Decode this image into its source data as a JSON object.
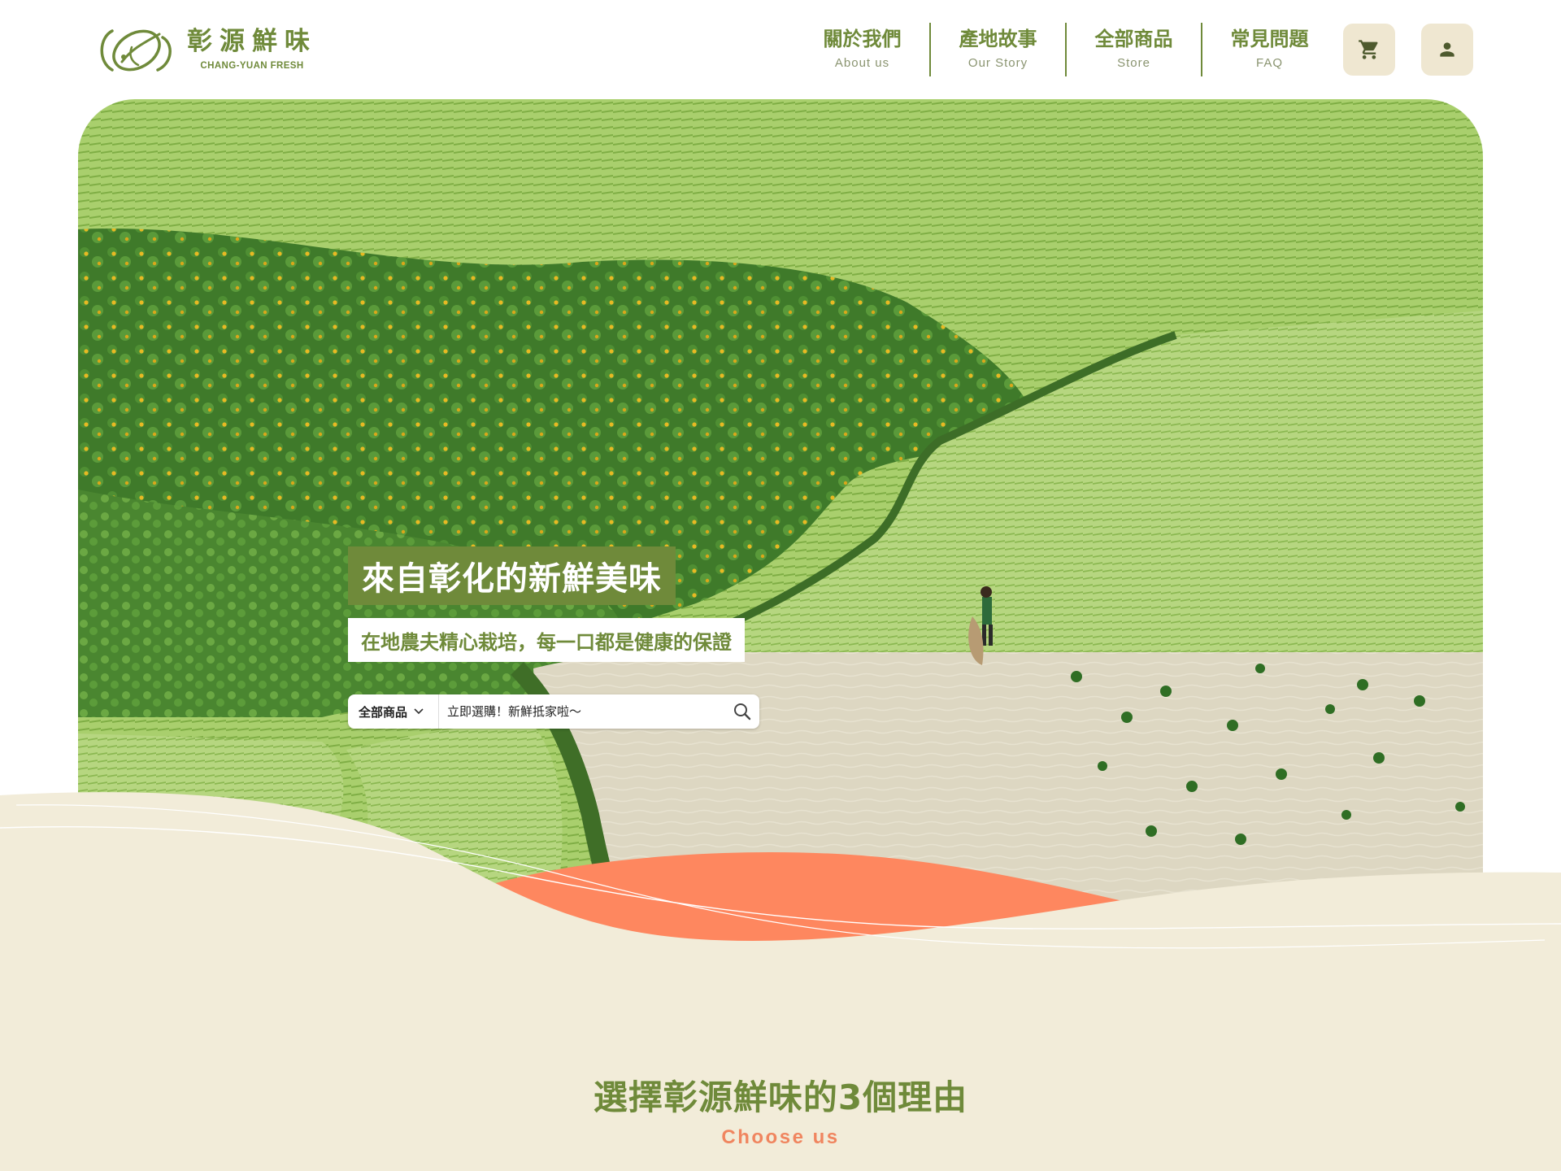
{
  "brand": {
    "name_zh": "彰源鮮味",
    "name_en": "CHANG-YUAN FRESH",
    "colors": {
      "primary": "#6f8a3a",
      "accent": "#f0855f",
      "cream": "#f2ecd9",
      "button_bg": "#efe7d1"
    }
  },
  "nav": {
    "items": [
      {
        "zh": "關於我們",
        "en": "About us"
      },
      {
        "zh": "產地故事",
        "en": "Our Story"
      },
      {
        "zh": "全部商品",
        "en": "Store"
      },
      {
        "zh": "常見問題",
        "en": "FAQ"
      }
    ],
    "cart_icon": "cart-icon",
    "user_icon": "user-icon"
  },
  "hero": {
    "title": "來自彰化的新鮮美味",
    "subtitle": "在地農夫精心栽培，每一口都是健康的保證",
    "image_icon": "farmland-photo",
    "search": {
      "category": "全部商品",
      "placeholder": "立即選購！新鮮抵家啦～",
      "search_icon": "search-icon"
    }
  },
  "reasons": {
    "title": "選擇彰源鮮味的3個理由",
    "subtitle": "Choose us"
  }
}
